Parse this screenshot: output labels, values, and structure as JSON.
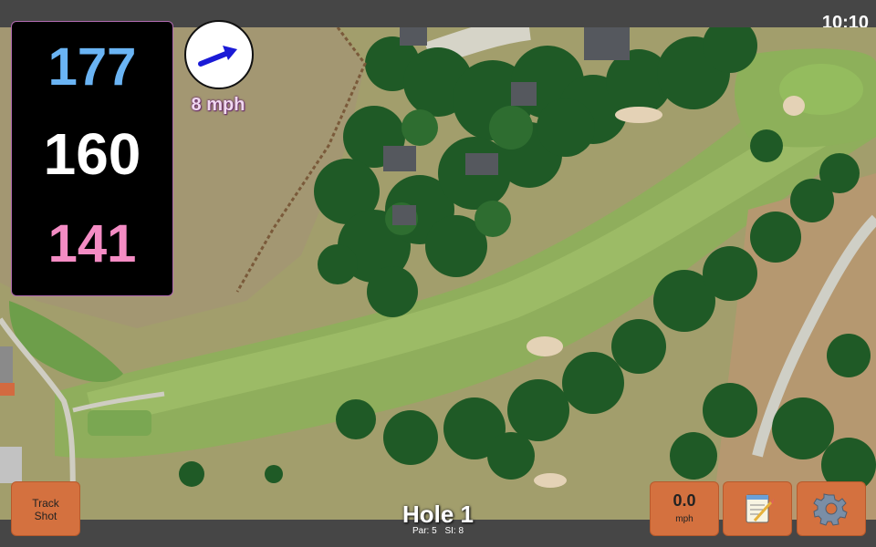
{
  "status": {
    "time": "10:10"
  },
  "yardages": {
    "back": "177",
    "middle": "160",
    "front": "141"
  },
  "wind": {
    "speed_label": "8 mph",
    "direction_icon": "wind-arrow-icon"
  },
  "hole": {
    "title": "Hole 1",
    "par_label": "Par: 5",
    "si_label": "SI: 8"
  },
  "buttons": {
    "track_shot_line1": "Track",
    "track_shot_line2": "Shot",
    "speed_value": "0.0",
    "speed_unit": "mph",
    "notes_icon": "notepad-icon",
    "settings_icon": "gear-icon"
  },
  "colors": {
    "back_yardage": "#6ab4f4",
    "middle_yardage": "#ffffff",
    "front_yardage": "#f48cc4",
    "button": "#d4713f"
  }
}
